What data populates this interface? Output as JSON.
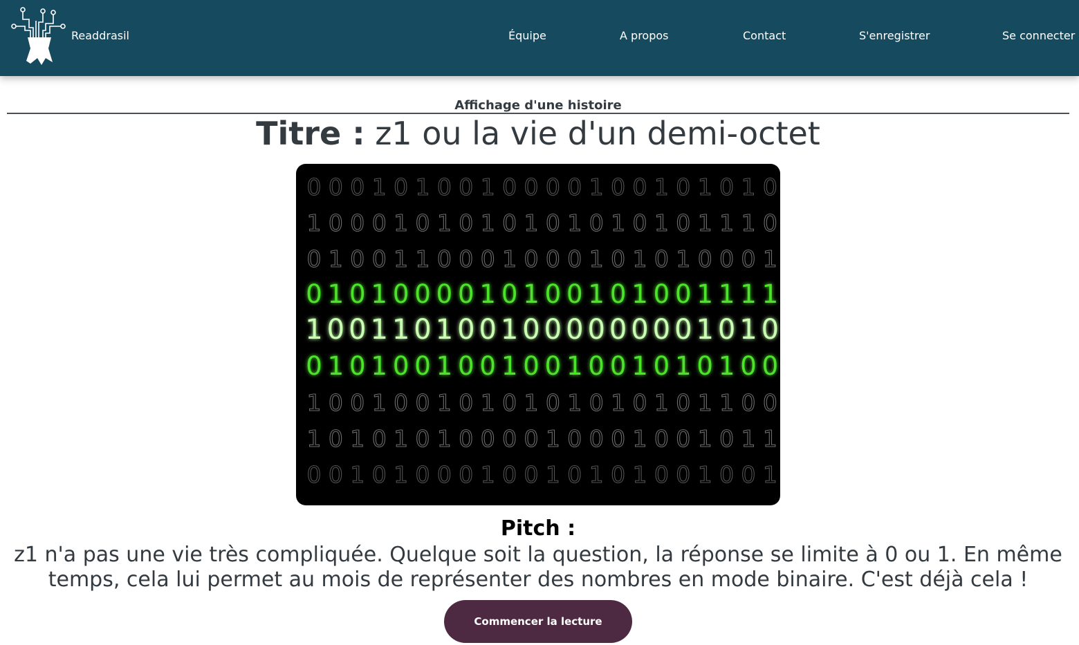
{
  "header": {
    "brand": "Readdrasil",
    "nav": [
      {
        "label": "Équipe"
      },
      {
        "label": "A propos"
      },
      {
        "label": "Contact"
      },
      {
        "label": "S'enregistrer"
      },
      {
        "label": "Se connecter"
      }
    ]
  },
  "main": {
    "section_heading": "Affichage d'une histoire",
    "title_label": "Titre :",
    "title_value": "z1 ou la vie d'un demi-octet",
    "cover_rows": [
      "0001010010000100101010",
      "1000101010101010101110",
      "0100110001000101010001",
      "0101000010100101001111",
      "1001101001000000001010",
      "0101001001001001010100",
      "1001001010101010101100",
      "1010101000010001001011",
      "0010100010010101001001"
    ],
    "pitch_heading": "Pitch :",
    "pitch_text": "z1 n'a pas une vie très compliquée. Quelque soit la question, la réponse se limite à 0 ou 1. En même temps, cela lui permet au mois de représenter des nombres en mode binaire. C'est déjà cela !",
    "start_button": "Commencer la lecture"
  },
  "colors": {
    "navbar": "#164b5f",
    "button": "#4e2942",
    "text": "#333a40",
    "binary_green": "#5bff3a",
    "binary_grey": "#8a8a8a"
  },
  "icons": {
    "logo": "tree-circuit-logo-icon"
  }
}
